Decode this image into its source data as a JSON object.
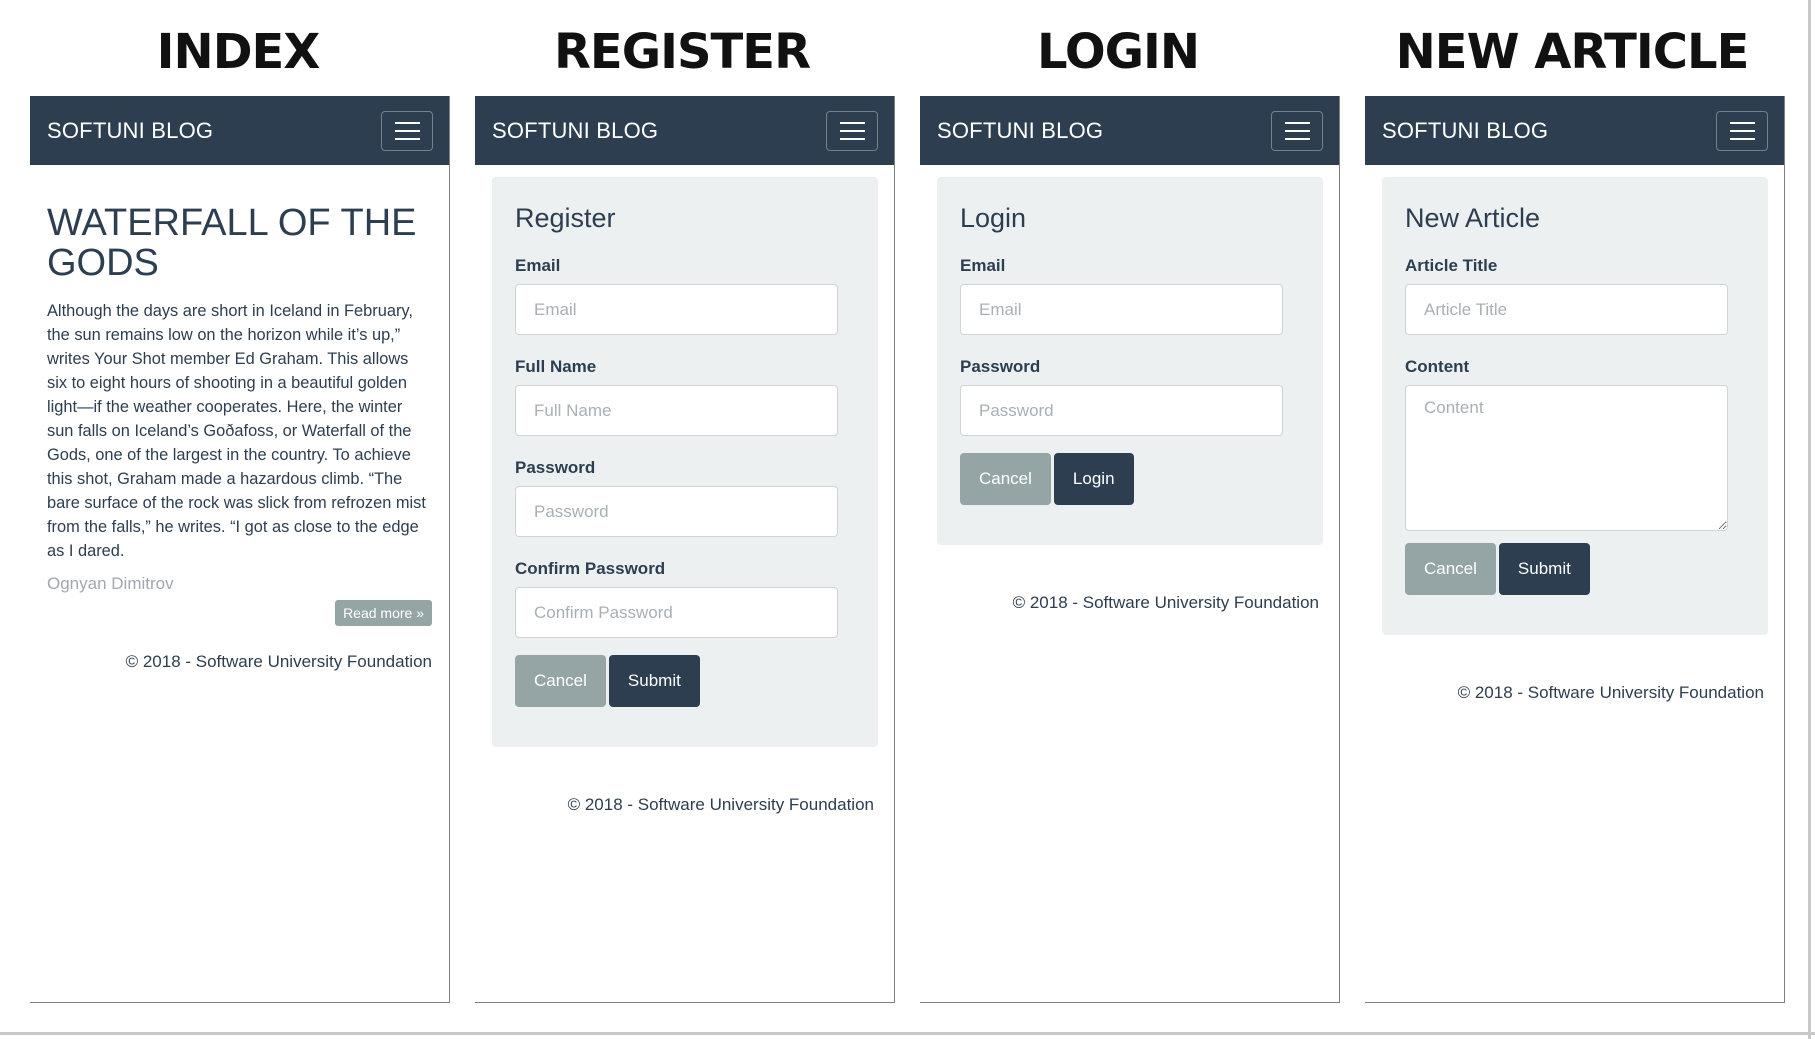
{
  "headings": {
    "index": "INDEX",
    "register": "REGISTER",
    "login": "LOGIN",
    "new_article": "NEW ARTICLE"
  },
  "navbar": {
    "brand": "SOFTUNI BLOG",
    "toggler_icon": "hamburger-menu-icon"
  },
  "index": {
    "article_title": "WATERFALL OF THE GODS",
    "article_body": "Although the days are short in Iceland in February, the sun remains low on the horizon while it’s up,” writes Your Shot member Ed Graham. This allows six to eight hours of shooting in a beautiful golden light—if the weather cooperates. Here, the winter sun falls on Iceland’s Goðafoss, or Waterfall of the Gods, one of the largest in the country. To achieve this shot, Graham made a hazardous climb. “The bare surface of the rock was slick from refrozen mist from the falls,” he writes. “I got as close to the edge as I dared.",
    "author": "Ognyan Dimitrov",
    "read_more": "Read more »"
  },
  "register": {
    "title": "Register",
    "email_label": "Email",
    "email_placeholder": "Email",
    "fullname_label": "Full Name",
    "fullname_placeholder": "Full Name",
    "password_label": "Password",
    "password_placeholder": "Password",
    "confirm_label": "Confirm Password",
    "confirm_placeholder": "Confirm Password",
    "cancel": "Cancel",
    "submit": "Submit"
  },
  "login": {
    "title": "Login",
    "email_label": "Email",
    "email_placeholder": "Email",
    "password_label": "Password",
    "password_placeholder": "Password",
    "cancel": "Cancel",
    "submit": "Login"
  },
  "new_article": {
    "title": "New Article",
    "title_label": "Article Title",
    "title_placeholder": "Article Title",
    "content_label": "Content",
    "content_placeholder": "Content",
    "cancel": "Cancel",
    "submit": "Submit"
  },
  "footer": "© 2018 - Software University Foundation",
  "colors": {
    "navbar": "#2c3e50",
    "well": "#ecf0f1",
    "cancel_button": "#95a5a6",
    "primary_button": "#2c3e50"
  }
}
